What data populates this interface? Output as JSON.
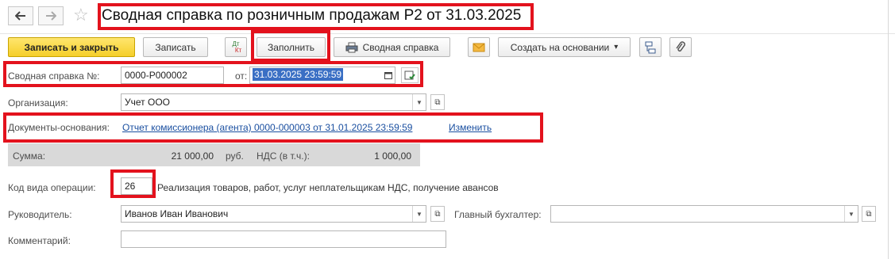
{
  "nav": {
    "back_icon": "arrow-left-icon",
    "forward_icon": "arrow-right-icon",
    "favorite_icon": "star-icon"
  },
  "window_title": "Сводная справка по розничным продажам Р2 от 31.03.2025",
  "toolbar": {
    "save_close": "Записать и закрыть",
    "save": "Записать",
    "dtkt_top": "Дт",
    "dtkt_bottom": "Кт",
    "fill": "Заполнить",
    "summary_print": "Сводная справка",
    "create_based": "Создать на основании",
    "dropdown_arrow": "▾"
  },
  "form": {
    "number_label": "Сводная справка №:",
    "number_value": "0000-Р000002",
    "date_label": "от:",
    "date_value": "31.03.2025 23:59:59",
    "org_label": "Организация:",
    "org_value": "Учет ООО",
    "base_docs_label": "Документы-основания:",
    "base_doc_link": "Отчет комиссионера (агента) 0000-000003 от 31.01.2025 23:59:59",
    "change_link": "Изменить",
    "sum_label": "Сумма:",
    "sum_value": "21 000,00",
    "currency": "руб.",
    "vat_label": "НДС (в т.ч.):",
    "vat_value": "1 000,00",
    "op_code_label": "Код вида операции:",
    "op_code_value": "26",
    "op_code_desc": "Реализация товаров, работ, услуг неплательщикам НДС, получение авансов",
    "head_label": "Руководитель:",
    "head_value": "Иванов Иван Иванович",
    "chief_acc_label": "Главный бухгалтер:",
    "chief_acc_value": "",
    "comment_label": "Комментарий:",
    "comment_value": ""
  },
  "colors": {
    "highlight": "#e3121d",
    "primary_button": "#f5cf2a",
    "link": "#1a4fa0",
    "selection": "#3a6fc4"
  }
}
